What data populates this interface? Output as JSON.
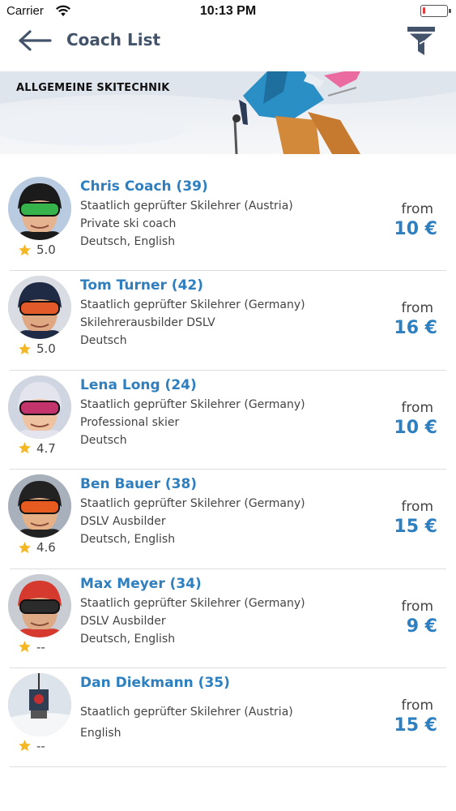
{
  "status_bar": {
    "carrier": "Carrier",
    "time": "10:13 PM",
    "battery_level": 0.1,
    "battery_color": "#e23b3b"
  },
  "nav": {
    "title": "Coach List",
    "back_icon": "arrow-left-icon",
    "filter_icon": "funnel-icon"
  },
  "banner": {
    "title": "ALLGEMEINE SKITECHNIK"
  },
  "colors": {
    "accent": "#2d7fc0",
    "title": "#43546a",
    "star": "#f5b823"
  },
  "coaches": [
    {
      "name": "Chris Coach (39)",
      "lines": [
        "Staatlich geprüfter Skilehrer (Austria)",
        "Private ski coach",
        "Deutsch, English"
      ],
      "rating": "5.0",
      "price_from": "from",
      "price": "10 €"
    },
    {
      "name": "Tom Turner (42)",
      "lines": [
        "Staatlich geprüfter Skilehrer (Germany)",
        "Skilehrerausbilder DSLV",
        "Deutsch"
      ],
      "rating": "5.0",
      "price_from": "from",
      "price": "16 €"
    },
    {
      "name": "Lena Long (24)",
      "lines": [
        "Staatlich geprüfter Skilehrer (Germany)",
        "Professional skier",
        "Deutsch"
      ],
      "rating": "4.7",
      "price_from": "from",
      "price": "10 €"
    },
    {
      "name": "Ben Bauer (38)",
      "lines": [
        "Staatlich geprüfter Skilehrer (Germany)",
        "DSLV Ausbilder",
        "Deutsch, English"
      ],
      "rating": "4.6",
      "price_from": "from",
      "price": "15 €"
    },
    {
      "name": "Max Meyer (34)",
      "lines": [
        "Staatlich geprüfter Skilehrer (Germany)",
        "DSLV Ausbilder",
        "Deutsch, English"
      ],
      "rating": "--",
      "price_from": "from",
      "price": "9 €"
    },
    {
      "name": "Dan Diekmann (35)",
      "lines": [
        "Staatlich geprüfter Skilehrer (Austria)",
        "English"
      ],
      "rating": "--",
      "price_from": "from",
      "price": "15 €"
    }
  ]
}
